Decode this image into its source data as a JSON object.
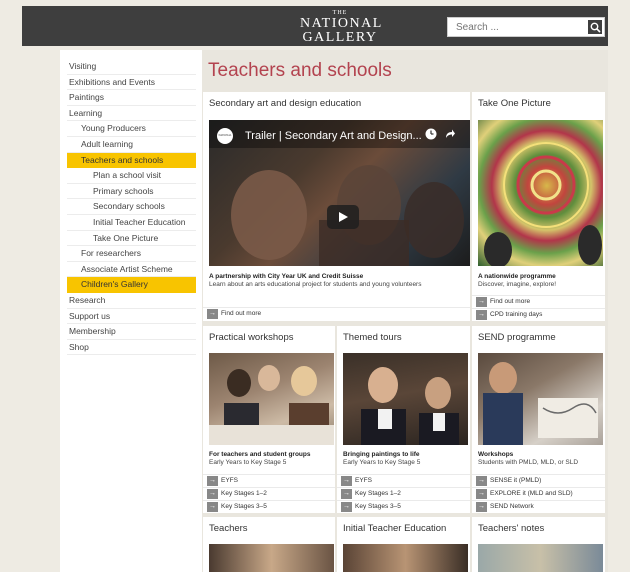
{
  "header": {
    "logo_the": "THE",
    "logo_line1": "NATIONAL",
    "logo_line2": "GALLERY",
    "search_placeholder": "Search ..."
  },
  "nav": [
    {
      "label": "Visiting",
      "level": 1
    },
    {
      "label": "Exhibitions and Events",
      "level": 1
    },
    {
      "label": "Paintings",
      "level": 1
    },
    {
      "label": "Learning",
      "level": 1
    },
    {
      "label": "Young Producers",
      "level": 2
    },
    {
      "label": "Adult learning",
      "level": 2
    },
    {
      "label": "Teachers and schools",
      "level": 2,
      "active": true
    },
    {
      "label": "Plan a school visit",
      "level": 3
    },
    {
      "label": "Primary schools",
      "level": 3
    },
    {
      "label": "Secondary schools",
      "level": 3
    },
    {
      "label": "Initial Teacher Education",
      "level": 3
    },
    {
      "label": "Take One Picture",
      "level": 3
    },
    {
      "label": "For researchers",
      "level": 2
    },
    {
      "label": "Associate Artist Scheme",
      "level": 2
    },
    {
      "label": "Children's Gallery",
      "level": 2,
      "active": true
    },
    {
      "label": "Research",
      "level": 1
    },
    {
      "label": "Support us",
      "level": 1
    },
    {
      "label": "Membership",
      "level": 1
    },
    {
      "label": "Shop",
      "level": 1
    }
  ],
  "page_title": "Teachers and schools",
  "secondary": {
    "title": "Secondary art and design education",
    "video_title": "Trailer | Secondary Art and Design...",
    "video_badge": "NATIONAL GALLERY",
    "sub_title": "A partnership with City Year UK and Credit Suisse",
    "sub_desc": "Learn about an arts educational project for students and young volunteers",
    "links": [
      "Find out more"
    ]
  },
  "take_one": {
    "title": "Take One Picture",
    "sub_title": "A nationwide programme",
    "sub_desc": "Discover, imagine, explore!",
    "links": [
      "Find out more",
      "CPD training days"
    ]
  },
  "practical": {
    "title": "Practical workshops",
    "sub_title": "For teachers and student groups",
    "sub_desc": "Early Years to Key Stage 5",
    "links": [
      "EYFS",
      "Key Stages 1–2",
      "Key Stages 3–5"
    ]
  },
  "themed": {
    "title": "Themed tours",
    "sub_title": "Bringing paintings to life",
    "sub_desc": "Early Years to Key Stage 5",
    "links": [
      "EYFS",
      "Key Stages 1–2",
      "Key Stages 3–5"
    ]
  },
  "send": {
    "title": "SEND programme",
    "sub_title": "Workshops",
    "sub_desc": "Students with PMLD, MLD, or SLD",
    "links": [
      "SENSE it (PMLD)",
      "EXPLORE it (MLD and SLD)",
      "SEND Network"
    ]
  },
  "bottom": {
    "teachers_title": "Teachers",
    "ite_title": "Initial Teacher Education",
    "notes_title": "Teachers' notes"
  },
  "arrow_glyph": "→"
}
